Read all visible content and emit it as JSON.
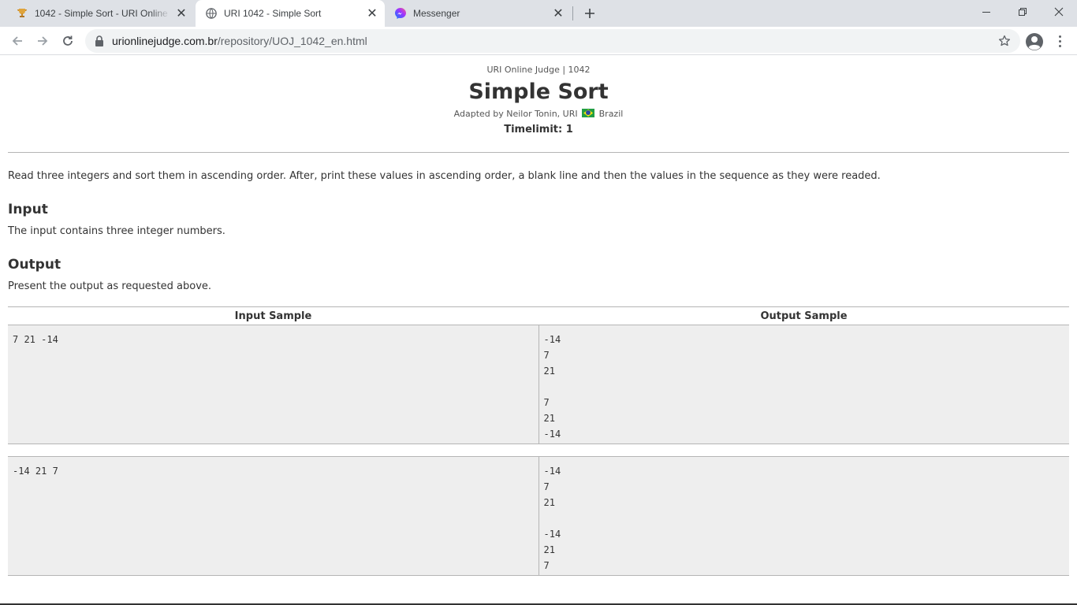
{
  "browser": {
    "tabs": [
      {
        "title": "1042 - Simple Sort - URI Online Judge",
        "icon": "trophy-icon"
      },
      {
        "title": "URI 1042 - Simple Sort",
        "icon": "globe-icon"
      },
      {
        "title": "Messenger",
        "icon": "messenger-icon"
      }
    ],
    "url_host": "urionlinejudge.com.br",
    "url_path": "/repository/UOJ_1042_en.html"
  },
  "problem": {
    "crumb": "URI Online Judge | 1042",
    "title": "Simple Sort",
    "adapted_prefix": "Adapted by Neilor Tonin, URI",
    "country": "Brazil",
    "timelimit": "Timelimit: 1",
    "description": "Read three integers and sort them in ascending order. After, print these values in ascending order, a blank line and then the values in the sequence as they were readed.",
    "input_heading": "Input",
    "input_text": "The input contains three integer numbers.",
    "output_heading": "Output",
    "output_text": "Present the output as requested above."
  },
  "samples": {
    "input_header": "Input Sample",
    "output_header": "Output Sample",
    "cases": [
      {
        "input": "7 21 -14",
        "output": "-14\n7\n21\n\n7\n21\n-14"
      },
      {
        "input": "-14 21 7",
        "output": "-14\n7\n21\n\n-14\n21\n7"
      }
    ]
  }
}
